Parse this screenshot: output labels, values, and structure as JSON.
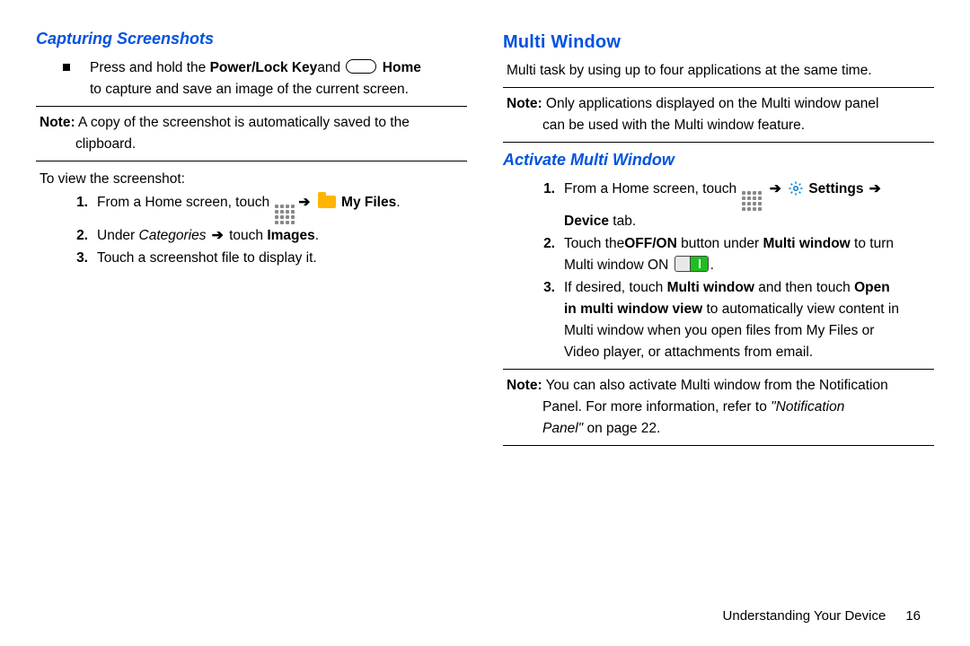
{
  "left": {
    "heading": "Capturing Screenshots",
    "bullet": {
      "pre": "Press and hold the ",
      "powerkey": "Power/Lock Key",
      "and": "and ",
      "home": " Home",
      "line2": "to capture and save an image of the current screen."
    },
    "note1": {
      "label": "Note:",
      "text": " A copy of the screenshot is automatically saved to the",
      "text2": "clipboard."
    },
    "intro": "To view the screenshot:",
    "steps": {
      "s1": {
        "n": "1.",
        "pre": "From a Home screen, touch ",
        "arrow": "➔",
        "myfiles": " My Files",
        "dot": "."
      },
      "s2": {
        "n": "2.",
        "pre": "Under ",
        "cat": "Categories",
        "arrow": " ➔ ",
        "touch": "touch ",
        "images": "Images",
        "dot": "."
      },
      "s3": {
        "n": "3.",
        "text": "Touch a screenshot file to display it."
      }
    }
  },
  "right": {
    "heading": "Multi Window",
    "intro": "Multi task by using up to four applications at the same time.",
    "note1": {
      "label": "Note:",
      "text": " Only applications displayed on the Multi window panel",
      "text2": "can be used with the Multi window feature."
    },
    "subheading": "Activate Multi Window",
    "steps": {
      "s1": {
        "n": "1.",
        "pre": "From a Home screen, touch ",
        "arrow1": " ➔ ",
        "settings": " Settings",
        "arrow2": " ➔",
        "line2a": "Device",
        "line2b": " tab."
      },
      "s2": {
        "n": "2.",
        "pre": "Touch the",
        "offon": "OFF/ON",
        "mid": "  button under ",
        "mw": "Multi window",
        "post": " to turn",
        "line2a": "Multi window ON ",
        "dot": "."
      },
      "s3": {
        "n": "3.",
        "pre": "If desired, touch ",
        "mw": "Multi window",
        "and": " and then touch ",
        "open": "Open",
        "l2a": "in multi window view",
        "l2b": " to automatically view content in",
        "l3": "Multi window when you open files from My Files or",
        "l4": "Video player, or attachments from email."
      }
    },
    "note2": {
      "label": "Note:",
      "text": " You can also activate Multi window from the Notification",
      "text2a": "Panel. For more information, refer to ",
      "ref": "\"Notification",
      "text3a": "Panel\"",
      "text3b": " on page 22."
    }
  },
  "footer": {
    "section": "Understanding Your Device",
    "page": "16"
  }
}
